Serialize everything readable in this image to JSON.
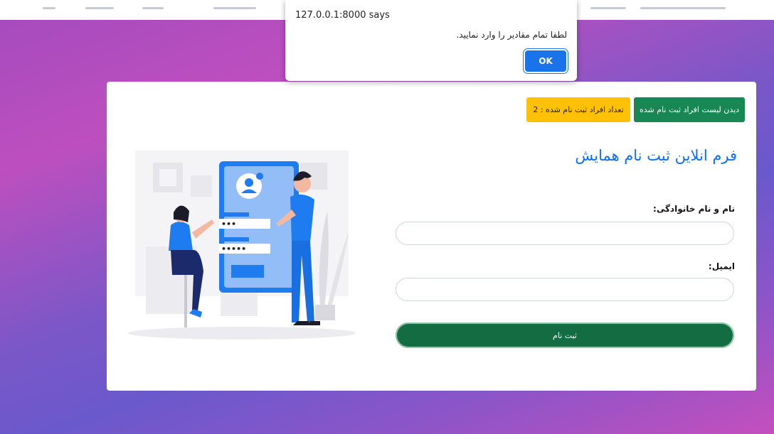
{
  "dialog": {
    "title": "127.0.0.1:8000 says",
    "message": "لطفا تمام مقادیر را وارد نمایید.",
    "ok_label": "OK"
  },
  "header": {
    "list_button_label": "دیدن لیست افراد ثبت نام شده",
    "count_badge_label": "تعداد افراد ثبت نام شده : 2"
  },
  "form": {
    "title": "فرم انلاین ثبت نام همایش",
    "name_label": "نام و نام خانوادگی:",
    "name_value": "",
    "email_label": "ایمیل:",
    "email_value": "",
    "submit_label": "ثبت نام"
  },
  "illustration": {
    "password_short": "•••",
    "password_long": "•••••"
  },
  "colors": {
    "primary": "#0d6efd",
    "success": "#198754",
    "warning": "#ffc107",
    "illustration_blue": "#1e7bf0"
  }
}
